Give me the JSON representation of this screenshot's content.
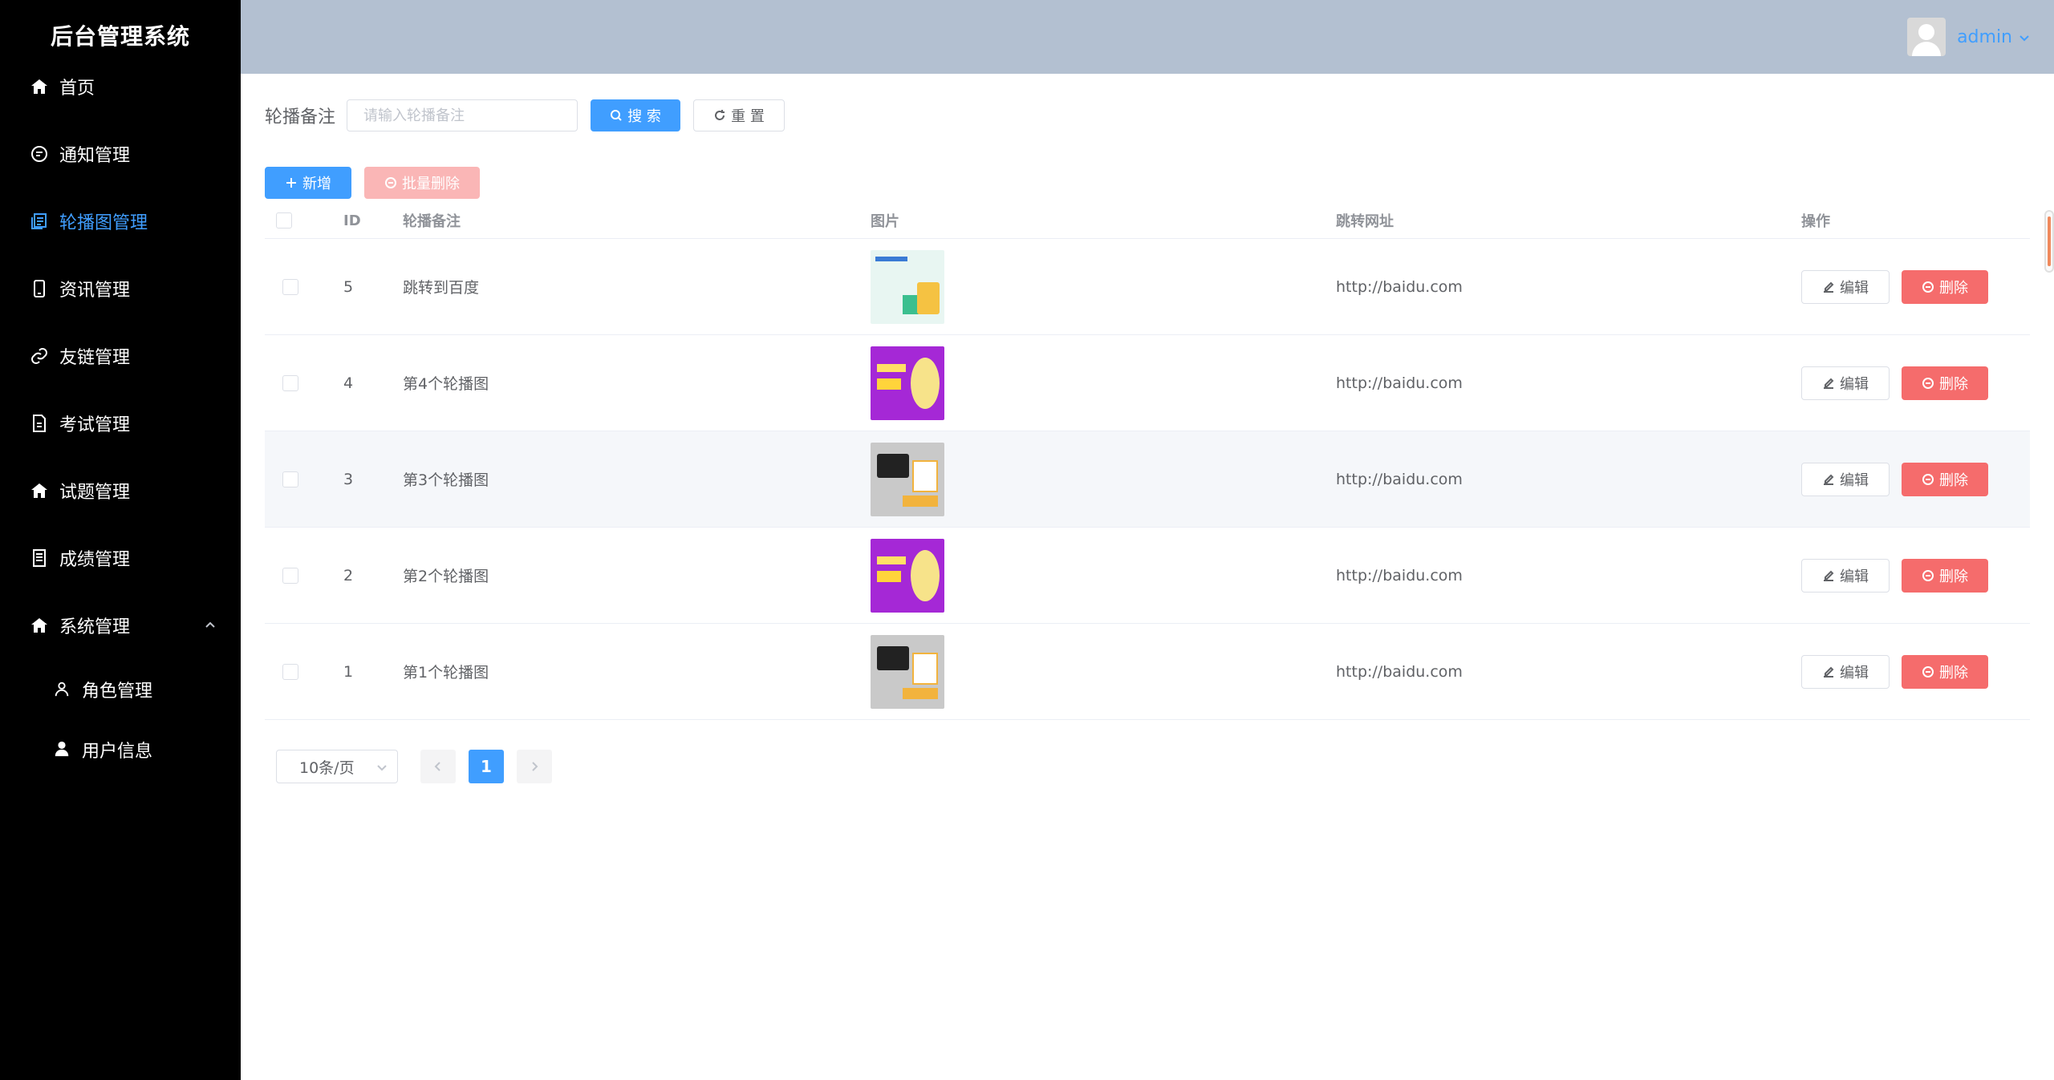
{
  "app": {
    "title": "后台管理系统"
  },
  "sidebar": {
    "items": [
      {
        "label": "首页",
        "icon": "home-icon"
      },
      {
        "label": "通知管理",
        "icon": "chat-icon"
      },
      {
        "label": "轮播图管理",
        "icon": "copy-document-icon",
        "active": true
      },
      {
        "label": "资讯管理",
        "icon": "mobile-icon"
      },
      {
        "label": "友链管理",
        "icon": "link-icon"
      },
      {
        "label": "考试管理",
        "icon": "document-icon"
      },
      {
        "label": "试题管理",
        "icon": "home-icon"
      },
      {
        "label": "成绩管理",
        "icon": "tickets-icon"
      },
      {
        "label": "系统管理",
        "icon": "home-icon",
        "expanded": true
      }
    ],
    "subitems": [
      {
        "label": "角色管理",
        "icon": "user-outline-icon"
      },
      {
        "label": "用户信息",
        "icon": "user-solid-icon"
      }
    ]
  },
  "header": {
    "username": "admin"
  },
  "search": {
    "label": "轮播备注",
    "placeholder": "请输入轮播备注",
    "value": "",
    "search_label": "搜 索",
    "reset_label": "重 置"
  },
  "toolbar": {
    "add_label": "新增",
    "batch_delete_label": "批量删除"
  },
  "table": {
    "columns": [
      "ID",
      "轮播备注",
      "图片",
      "跳转网址",
      "操作"
    ],
    "rows": [
      {
        "id": "5",
        "remark": "跳转到百度",
        "image": "banner-exam-system",
        "url": "http://baidu.com"
      },
      {
        "id": "4",
        "remark": "第4个轮播图",
        "image": "banner-purple-launch",
        "url": "http://baidu.com"
      },
      {
        "id": "3",
        "remark": "第3个轮播图",
        "image": "banner-grey-exam",
        "url": "http://baidu.com"
      },
      {
        "id": "2",
        "remark": "第2个轮播图",
        "image": "banner-purple-launch",
        "url": "http://baidu.com"
      },
      {
        "id": "1",
        "remark": "第1个轮播图",
        "image": "banner-grey-exam",
        "url": "http://baidu.com"
      }
    ],
    "edit_label": "编辑",
    "delete_label": "删除"
  },
  "pagination": {
    "page_size_label": "10条/页",
    "current_page": "1"
  },
  "colors": {
    "primary": "#409eff",
    "danger": "#f56c6c",
    "sidebar_bg": "#000000",
    "header_bg": "#b3c0d1"
  }
}
